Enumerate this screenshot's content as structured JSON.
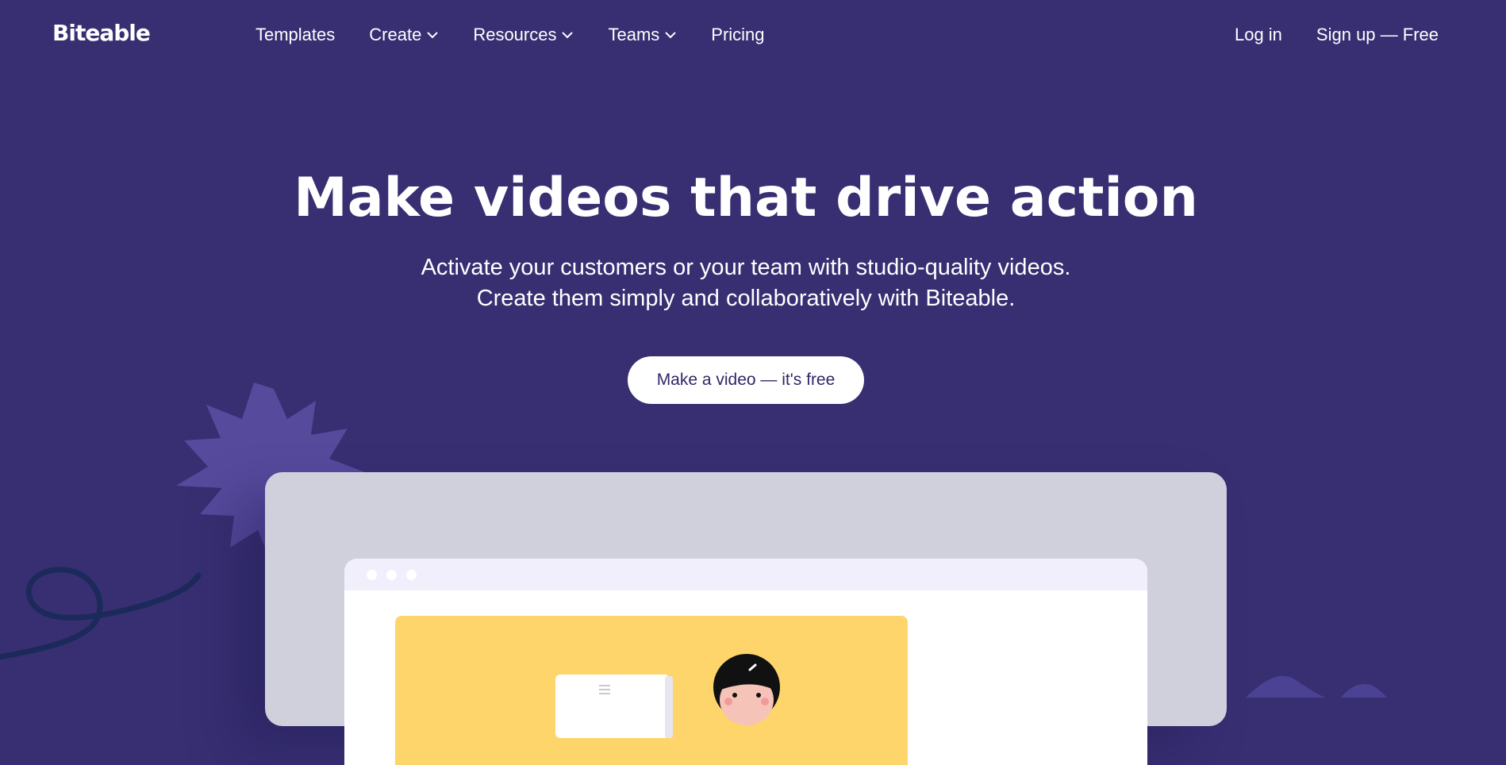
{
  "brand": {
    "logo_text": "Biteable"
  },
  "nav": {
    "links": [
      {
        "label": "Templates",
        "has_dropdown": false
      },
      {
        "label": "Create",
        "has_dropdown": true
      },
      {
        "label": "Resources",
        "has_dropdown": true
      },
      {
        "label": "Teams",
        "has_dropdown": true
      },
      {
        "label": "Pricing",
        "has_dropdown": false
      }
    ],
    "login_label": "Log in",
    "signup_label": "Sign up — Free"
  },
  "hero": {
    "title": "Make videos that drive action",
    "subtitle_line1": "Activate your customers or your team with studio-quality videos.",
    "subtitle_line2": "Create them simply and collaboratively with Biteable.",
    "cta_label": "Make a video — it's free"
  },
  "colors": {
    "background": "#372f72",
    "cta_text": "#2e2768",
    "starburst": "#5a4fa3",
    "laptop_frame": "#d0d0dd",
    "browser_bar": "#f1effb",
    "video_card": "#fdd56a",
    "squiggle": "#1b2a5a"
  },
  "icons": {
    "chevron": "chevron-down-icon",
    "browser_dots": [
      "browser-dot-icon",
      "browser-dot-icon",
      "browser-dot-icon"
    ]
  }
}
